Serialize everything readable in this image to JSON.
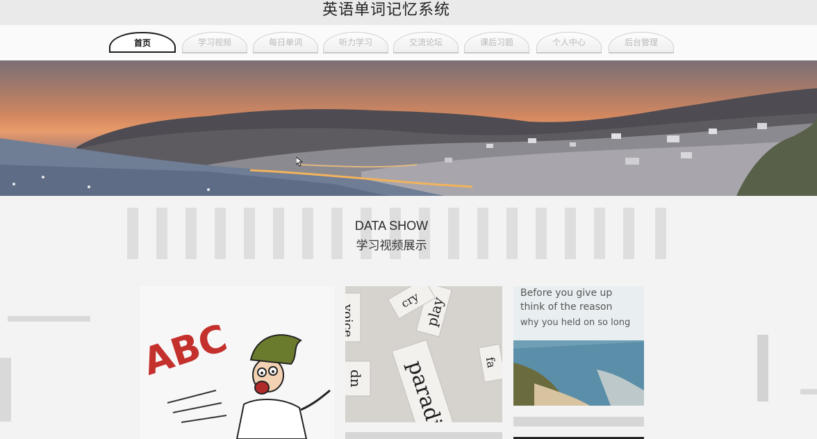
{
  "site": {
    "title": "英语单词记忆系统"
  },
  "nav": {
    "items": [
      {
        "label": "首页"
      },
      {
        "label": "学习视频"
      },
      {
        "label": "每日单词"
      },
      {
        "label": "听力学习"
      },
      {
        "label": "交流论坛"
      },
      {
        "label": "课后习题"
      },
      {
        "label": "个人中心"
      },
      {
        "label": "后台管理"
      }
    ],
    "active_index": 0
  },
  "section": {
    "title_en": "DATA SHOW",
    "title_zh": "学习视频展示"
  },
  "cards": [
    {
      "image_text": "ABC"
    },
    {
      "words": [
        "paradise",
        "play",
        "dn",
        "voice",
        "cry",
        "fa"
      ]
    },
    {
      "quote_lines": [
        "Before you give up",
        "think of the reason",
        "why you held on so long"
      ]
    }
  ],
  "colors": {
    "active_border": "#1a1a1a",
    "nav_inactive_text": "#b9b9b9",
    "page_bg": "#f3f3f3"
  }
}
